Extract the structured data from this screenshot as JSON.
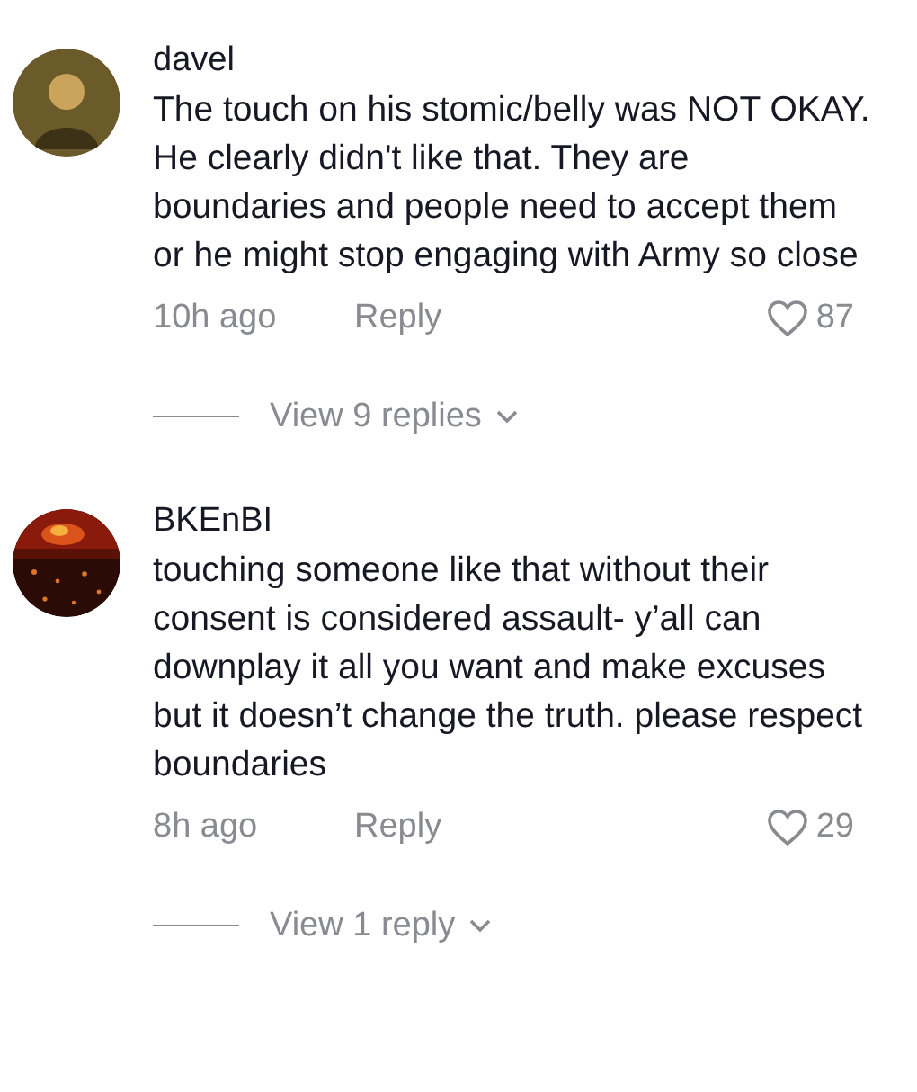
{
  "comments": [
    {
      "avatar": {
        "kind": "person"
      },
      "username": "davel",
      "text": "The touch on his stomic/belly was NOT OKAY. He clearly didn't like that. They are boundaries and people need to accept them or he might stop engaging with Army so close",
      "time": "10h ago",
      "reply": "Reply",
      "likes": "87",
      "liked": false,
      "view_replies": "View 9 replies"
    },
    {
      "username": "BKEnBI",
      "text": "touching someone like that without their consent is considered assault- y’all can downplay it all you want and make excuses but it doesn’t change the truth. please respect boundaries",
      "time": "8h ago",
      "reply": "Reply",
      "likes": "29",
      "liked": false,
      "view_replies": "View 1 reply"
    }
  ]
}
